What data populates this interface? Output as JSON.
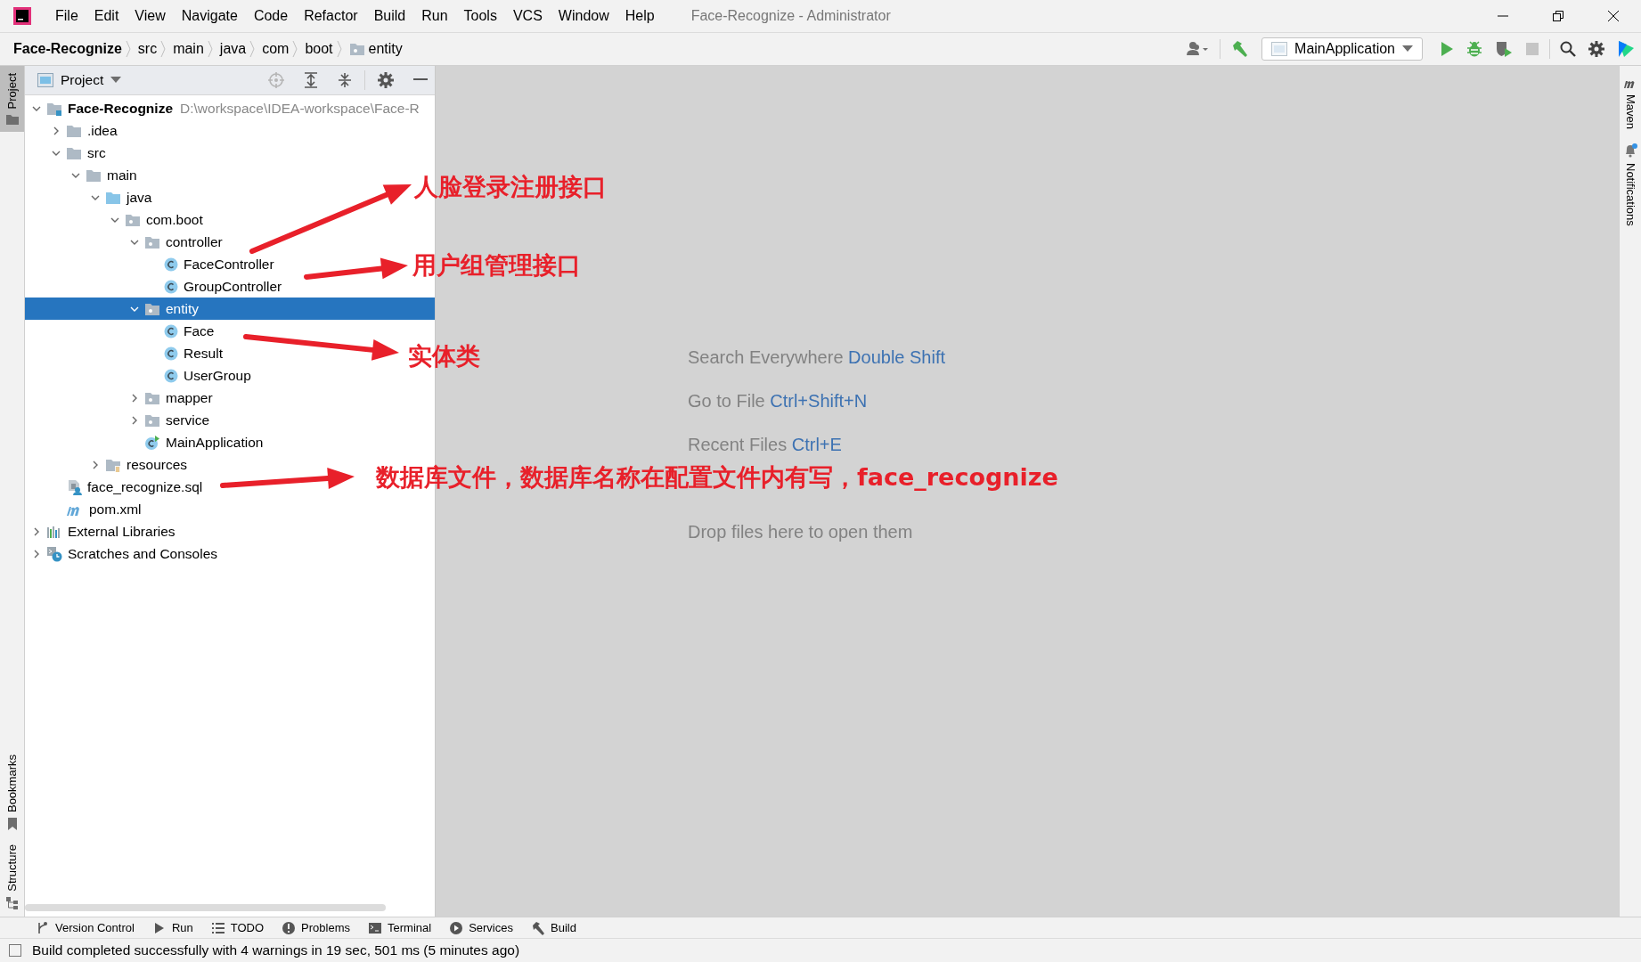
{
  "window": {
    "title": "Face-Recognize - Administrator"
  },
  "menu": [
    "File",
    "Edit",
    "View",
    "Navigate",
    "Code",
    "Refactor",
    "Build",
    "Run",
    "Tools",
    "VCS",
    "Window",
    "Help"
  ],
  "breadcrumbs": [
    {
      "label": "Face-Recognize",
      "kind": "project"
    },
    {
      "label": "src",
      "kind": "plain"
    },
    {
      "label": "main",
      "kind": "plain"
    },
    {
      "label": "java",
      "kind": "plain"
    },
    {
      "label": "com",
      "kind": "plain"
    },
    {
      "label": "boot",
      "kind": "plain"
    },
    {
      "label": "entity",
      "kind": "package"
    }
  ],
  "run_configuration": "MainApplication",
  "left_stripe": [
    {
      "label": "Project",
      "selected": true
    },
    {
      "label": "Bookmarks",
      "selected": false
    },
    {
      "label": "Structure",
      "selected": false
    }
  ],
  "right_stripe": [
    {
      "label": "Maven",
      "kind": "maven"
    },
    {
      "label": "Notifications",
      "kind": "notifications"
    }
  ],
  "project_panel": {
    "title": "Project",
    "tree": [
      {
        "label": "Face-Recognize",
        "kind": "project",
        "path": "D:\\workspace\\IDEA-workspace\\Face-R",
        "expanded": true,
        "selected": false,
        "children": [
          {
            "label": ".idea",
            "kind": "folder",
            "expanded": false,
            "selected": false
          },
          {
            "label": "src",
            "kind": "folder",
            "expanded": true,
            "selected": false,
            "children": [
              {
                "label": "main",
                "kind": "folder",
                "expanded": true,
                "selected": false,
                "children": [
                  {
                    "label": "java",
                    "kind": "source",
                    "expanded": true,
                    "selected": false,
                    "children": [
                      {
                        "label": "com.boot",
                        "kind": "package",
                        "expanded": true,
                        "selected": false,
                        "children": [
                          {
                            "label": "controller",
                            "kind": "package",
                            "expanded": true,
                            "selected": false,
                            "children": [
                              {
                                "label": "FaceController",
                                "kind": "class",
                                "selected": false
                              },
                              {
                                "label": "GroupController",
                                "kind": "class",
                                "selected": false
                              }
                            ]
                          },
                          {
                            "label": "entity",
                            "kind": "package",
                            "expanded": true,
                            "selected": true,
                            "children": [
                              {
                                "label": "Face",
                                "kind": "class",
                                "selected": false
                              },
                              {
                                "label": "Result",
                                "kind": "class",
                                "selected": false
                              },
                              {
                                "label": "UserGroup",
                                "kind": "class",
                                "selected": false
                              }
                            ]
                          },
                          {
                            "label": "mapper",
                            "kind": "package",
                            "expanded": false,
                            "selected": false
                          },
                          {
                            "label": "service",
                            "kind": "package",
                            "expanded": false,
                            "selected": false
                          },
                          {
                            "label": "MainApplication",
                            "kind": "main",
                            "selected": false
                          }
                        ]
                      }
                    ]
                  },
                  {
                    "label": "resources",
                    "kind": "resources",
                    "expanded": false,
                    "selected": false
                  }
                ]
              }
            ]
          },
          {
            "label": "face_recognize.sql",
            "kind": "sql",
            "selected": false
          },
          {
            "label": "pom.xml",
            "kind": "maven",
            "selected": false
          }
        ]
      },
      {
        "label": "External Libraries",
        "kind": "libraries",
        "expanded": false,
        "selected": false
      },
      {
        "label": "Scratches and Consoles",
        "kind": "scratches",
        "expanded": false,
        "selected": false
      }
    ]
  },
  "editor_hints": [
    {
      "action": "Search Everywhere",
      "shortcut": "Double Shift"
    },
    {
      "action": "Go to File",
      "shortcut": "Ctrl+Shift+N"
    },
    {
      "action": "Recent Files",
      "shortcut": "Ctrl+E"
    },
    {
      "action": "Drop files here to open them"
    }
  ],
  "annotations": [
    {
      "text": "人脸登录注册接口"
    },
    {
      "text": "用户组管理接口"
    },
    {
      "text": "实体类"
    },
    {
      "text": "数据库文件，数据库名称在配置文件内有写，face_recognize"
    }
  ],
  "bottom_tools": [
    {
      "label": "Version Control",
      "kind": "vcs"
    },
    {
      "label": "Run",
      "kind": "run"
    },
    {
      "label": "TODO",
      "kind": "todo"
    },
    {
      "label": "Problems",
      "kind": "problems"
    },
    {
      "label": "Terminal",
      "kind": "terminal"
    },
    {
      "label": "Services",
      "kind": "services"
    },
    {
      "label": "Build",
      "kind": "build"
    }
  ],
  "status": "Build completed successfully with 4 warnings in 19 sec, 501 ms (5 minutes ago)"
}
